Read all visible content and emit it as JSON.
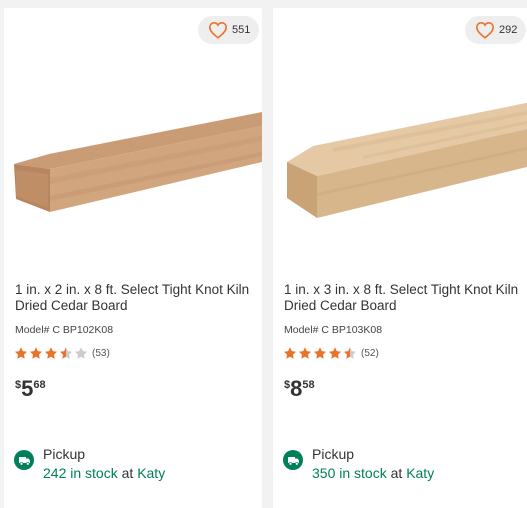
{
  "products": [
    {
      "favorites": "551",
      "title": "1 in. x 2 in. x 8 ft. Select Tight Knot Kiln Dried Cedar Board",
      "model": "Model# C BP102K08",
      "rating": 3.5,
      "review_count": "(53)",
      "price_currency": "$",
      "price_dollars": "5",
      "price_cents": "68",
      "pickup_label": "Pickup",
      "stock_count": "242 in stock",
      "stock_at": " at ",
      "stock_store": "Katy"
    },
    {
      "favorites": "292",
      "title": "1 in. x 3 in. x 8 ft. Select Tight Knot Kiln Dried Cedar Board",
      "model": "Model# C BP103K08",
      "rating": 4.5,
      "review_count": "(52)",
      "price_currency": "$",
      "price_dollars": "8",
      "price_cents": "58",
      "pickup_label": "Pickup",
      "stock_count": "350 in stock",
      "stock_at": " at ",
      "stock_store": "Katy"
    }
  ],
  "colors": {
    "star_filled": "#e8742c",
    "star_empty": "#cccccc",
    "stock_green": "#00805a",
    "heart": "#e8742c"
  }
}
